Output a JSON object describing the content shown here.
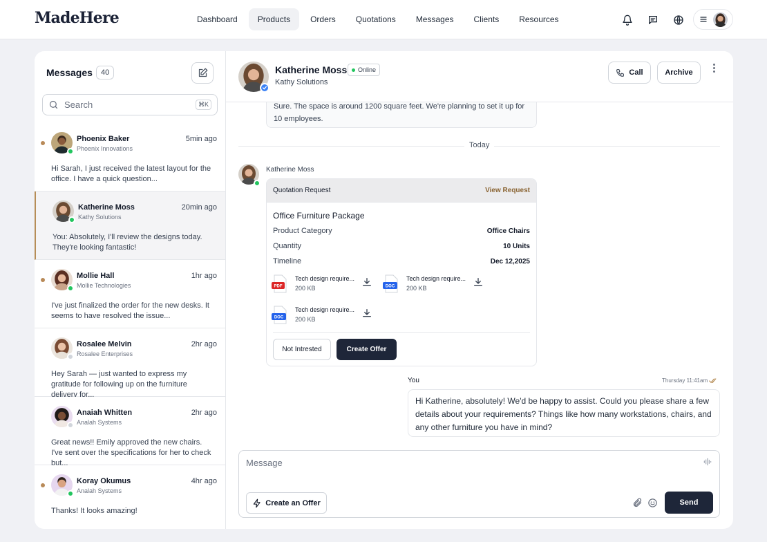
{
  "brand": {
    "logo": "MadeHere"
  },
  "nav": {
    "items": [
      "Dashboard",
      "Products",
      "Orders",
      "Quotations",
      "Messages",
      "Clients",
      "Resources"
    ],
    "active": "Products"
  },
  "header_icons": [
    "bell-icon",
    "chat-icon",
    "globe-icon",
    "menu-icon"
  ],
  "sidebar": {
    "title": "Messages",
    "count": "40",
    "search": {
      "placeholder": "Search",
      "shortcut": "⌘K"
    },
    "conversations": [
      {
        "name": "Phoenix Baker",
        "company": "Phoenix Innovations",
        "time": "5min ago",
        "preview": "Hi Sarah, I just received the latest layout for the office. I have a quick question...",
        "unread": true,
        "online": true,
        "active": false
      },
      {
        "name": "Katherine Moss",
        "company": "Kathy Solutions",
        "time": "20min ago",
        "preview": "You: Absolutely, I'll review the designs today. They're looking fantastic!",
        "unread": false,
        "online": true,
        "active": true
      },
      {
        "name": "Mollie Hall",
        "company": "Mollie Technologies",
        "time": "1hr ago",
        "preview": "I've just finalized the order for the new desks. It seems to have resolved the issue...",
        "unread": true,
        "online": true,
        "active": false
      },
      {
        "name": "Rosalee Melvin",
        "company": "Rosalee Enterprises",
        "time": "2hr ago",
        "preview": "Hey Sarah — just wanted to express my gratitude for following up on the furniture delivery for...",
        "unread": false,
        "online": false,
        "active": false
      },
      {
        "name": "Anaiah Whitten",
        "company": "Analah Systems",
        "time": "2hr ago",
        "preview": "Great news!! Emily approved the new chairs. I've sent over the specifications for her to check but...",
        "unread": false,
        "online": false,
        "active": false
      },
      {
        "name": "Koray Okumus",
        "company": "Analah Systems",
        "time": "4hr ago",
        "preview": "Thanks! It looks amazing!",
        "unread": true,
        "online": true,
        "active": false
      }
    ]
  },
  "chat": {
    "contact": {
      "name": "Katherine Moss",
      "status": "Online",
      "company": "Kathy Solutions"
    },
    "actions": {
      "call": "Call",
      "archive": "Archive"
    },
    "previous_message": "Sure. The space is around 1200 square feet. We're planning to set it up for 10 employees.",
    "divider": "Today",
    "sender": "Katherine Moss",
    "quotation": {
      "header": "Quotation Request",
      "view_link": "View Request",
      "package": "Office Furniture Package",
      "rows": [
        {
          "label": "Product Category",
          "value": "Office Chairs"
        },
        {
          "label": "Quantity",
          "value": "10 Units"
        },
        {
          "label": "Timeline",
          "value": "Dec 12,2025"
        }
      ],
      "attachments": [
        {
          "type": "PDF",
          "name": "Tech design require...",
          "size": "200 KB",
          "color": "#dc2626"
        },
        {
          "type": "DOC",
          "name": "Tech design require...",
          "size": "200 KB",
          "color": "#2563eb"
        },
        {
          "type": "DOC",
          "name": "Tech design require...",
          "size": "200 KB",
          "color": "#2563eb"
        }
      ],
      "not_interested": "Not Intrested",
      "create_offer": "Create Offer"
    },
    "reply": {
      "author": "You",
      "time": "Thursday 11:41am",
      "text": "Hi Katherine, absolutely! We'd be happy to assist. Could you please share a few details about your requirements? Things like how many workstations, chairs, and any other furniture you have in mind?"
    },
    "composer": {
      "placeholder": "Message",
      "create_offer": "Create an Offer",
      "send": "Send"
    }
  },
  "colors": {
    "accent": "#b68d57",
    "primary_button": "#1e2639",
    "link": "#8a6433",
    "online": "#22c55e"
  }
}
